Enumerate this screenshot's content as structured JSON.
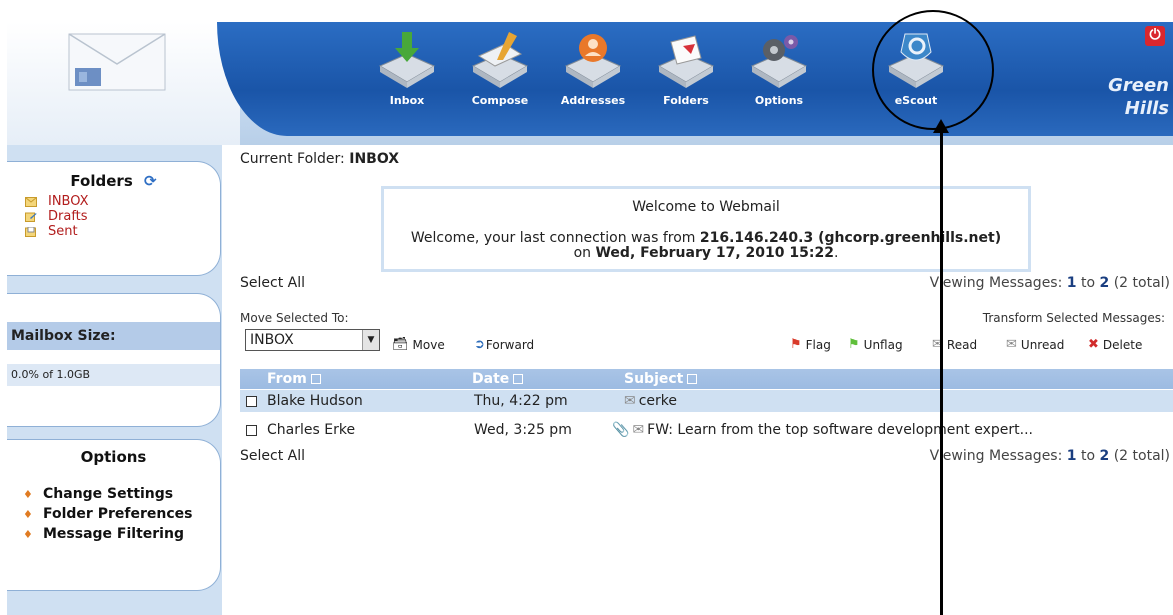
{
  "header": {
    "nav": [
      {
        "label": "Inbox",
        "icon": "inbox-icon"
      },
      {
        "label": "Compose",
        "icon": "compose-icon"
      },
      {
        "label": "Addresses",
        "icon": "addresses-icon"
      },
      {
        "label": "Folders",
        "icon": "folders-icon"
      },
      {
        "label": "Options",
        "icon": "options-icon"
      },
      {
        "label": "eScout",
        "icon": "escout-icon"
      }
    ],
    "brand_line1": "Green",
    "brand_line2": "Hills",
    "power_glyph": "⏻"
  },
  "sidebar": {
    "folders_title": "Folders",
    "folders": [
      {
        "label": "INBOX",
        "icon": "inbox-folder-icon"
      },
      {
        "label": "Drafts",
        "icon": "drafts-folder-icon"
      },
      {
        "label": "Sent",
        "icon": "sent-folder-icon"
      }
    ],
    "mailbox_title": "Mailbox Size:",
    "mailbox_usage": "0.0% of 1.0GB",
    "options_title": "Options",
    "options": [
      {
        "label": "Change Settings"
      },
      {
        "label": "Folder Preferences"
      },
      {
        "label": "Message Filtering"
      }
    ]
  },
  "main": {
    "current_folder_label": "Current Folder:",
    "current_folder": "INBOX",
    "welcome": {
      "title": "Welcome to Webmail",
      "line1_prefix": "Welcome, your last connection was from",
      "ip": "216.146.240.3 (ghcorp.greenhills.net)",
      "line2_prefix": "on",
      "date": "Wed, February 17, 2010 15:22",
      "line2_suffix": "."
    },
    "select_all": "Select All",
    "viewing": {
      "prefix": "Viewing Messages:",
      "from": "1",
      "to_word": "to",
      "to": "2",
      "total": "(2 total)"
    },
    "move_selected_label": "Move Selected To:",
    "move_target": "INBOX",
    "move_button": "Move",
    "forward_button": "Forward",
    "transform_label": "Transform Selected Messages:",
    "actions": {
      "flag": "Flag",
      "unflag": "Unflag",
      "read": "Read",
      "unread": "Unread",
      "delete": "Delete"
    },
    "columns": {
      "from": "From",
      "date": "Date",
      "subject": "Subject"
    },
    "messages": [
      {
        "from": "Blake Hudson",
        "date": "Thu, 4:22 pm",
        "subject": "cerke",
        "attachment": false
      },
      {
        "from": "Charles Erke",
        "date": "Wed, 3:25 pm",
        "subject": "FW: Learn from the top software development expert...",
        "attachment": true
      }
    ]
  },
  "colors": {
    "nav_band": "#1a55a8",
    "folder_link": "#b21d1d",
    "table_header": "#9cbbe2",
    "selected_row": "#cfe0f2"
  }
}
